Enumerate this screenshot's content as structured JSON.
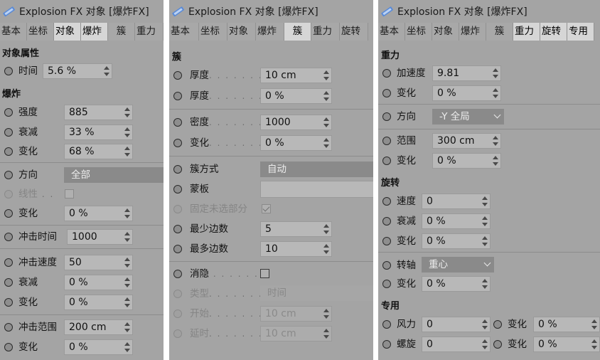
{
  "panels": [
    {
      "title": "Explosion FX 对象 [爆炸FX]",
      "tabs": [
        "基本",
        "坐标",
        "对象",
        "爆炸",
        "簇",
        "重力"
      ],
      "active_tab": "对象",
      "sections": [
        "对象属性",
        "爆炸"
      ],
      "params": {
        "time": {
          "label": "时间",
          "value": "5.6 %"
        },
        "strength": {
          "label": "强度",
          "value": "885"
        },
        "decay": {
          "label": "衰减",
          "value": "33 %"
        },
        "variation": {
          "label": "变化",
          "value": "68 %"
        },
        "direction": {
          "label": "方向",
          "value": "全部"
        },
        "linear": {
          "label": "线性"
        },
        "variation2": {
          "label": "变化",
          "value": "0 %"
        },
        "impact_time": {
          "label": "冲击时间",
          "value": "1000"
        },
        "impact_speed": {
          "label": "冲击速度",
          "value": "50"
        },
        "decay2": {
          "label": "衰减",
          "value": "0 %"
        },
        "variation3": {
          "label": "变化",
          "value": "0 %"
        },
        "impact_range": {
          "label": "冲击范围",
          "value": "200 cm"
        },
        "variation4": {
          "label": "变化",
          "value": "0 %"
        }
      }
    },
    {
      "title": "Explosion FX 对象 [爆炸FX]",
      "tabs": [
        "基本",
        "坐标",
        "对象",
        "爆炸",
        "簇",
        "重力",
        "旋转"
      ],
      "active_tab": "簇",
      "sections": [
        "簇"
      ],
      "dots": ". . . . . . . .",
      "params": {
        "thickness": {
          "label": "厚度",
          "value": "10 cm"
        },
        "thickness2": {
          "label": "厚度",
          "value": "0 %"
        },
        "density": {
          "label": "密度",
          "value": "1000"
        },
        "variation": {
          "label": "变化",
          "value": "0 %"
        },
        "cluster_mode": {
          "label": "簇方式",
          "value": "自动"
        },
        "mask": {
          "label": "蒙板",
          "value": ""
        },
        "fix_unselected": {
          "label": "固定未选部分"
        },
        "min_edges": {
          "label": "最少边数",
          "value": "5"
        },
        "max_edges": {
          "label": "最多边数",
          "value": "10"
        },
        "fade": {
          "label": "消隐"
        },
        "type": {
          "label": "类型",
          "value": "时间"
        },
        "start": {
          "label": "开始",
          "value": "10 cm"
        },
        "delay": {
          "label": "延时",
          "value": "10 cm"
        }
      }
    },
    {
      "title": "Explosion FX 对象 [爆炸FX]",
      "tabs": [
        "基本",
        "坐标",
        "对象",
        "爆炸",
        "簇",
        "重力",
        "旋转",
        "专用"
      ],
      "active_tab": "重力",
      "sections": [
        "重力",
        "旋转",
        "专用"
      ],
      "params": {
        "acceleration": {
          "label": "加速度",
          "value": "9.81"
        },
        "variation": {
          "label": "变化",
          "value": "0 %"
        },
        "direction": {
          "label": "方向",
          "value": "-Y 全局"
        },
        "range": {
          "label": "范围",
          "value": "300 cm"
        },
        "variation2": {
          "label": "变化",
          "value": "0 %"
        },
        "speed": {
          "label": "速度",
          "value": "0"
        },
        "decay": {
          "label": "衰减",
          "value": "0 %"
        },
        "variation3": {
          "label": "变化",
          "value": "0 %"
        },
        "axis": {
          "label": "转轴",
          "value": "重心"
        },
        "variation4": {
          "label": "变化",
          "value": "0 %"
        },
        "wind": {
          "label": "风力",
          "value": "0"
        },
        "wind_variation": {
          "label": "变化",
          "value": "0 %"
        },
        "spiral": {
          "label": "螺旋",
          "value": "0"
        },
        "spiral_variation": {
          "label": "变化",
          "value": "0 %"
        }
      }
    }
  ],
  "colors": {
    "panel_bg": "#a4a4a4",
    "tab_active": "#d6d6d6",
    "field_bg": "#b8b8b8",
    "dropdown_bg": "#8a8a8a"
  },
  "icons": {
    "title_icon": "explosion-fx-object-icon",
    "param_dot": "animation-keyframe-dot-icon"
  }
}
